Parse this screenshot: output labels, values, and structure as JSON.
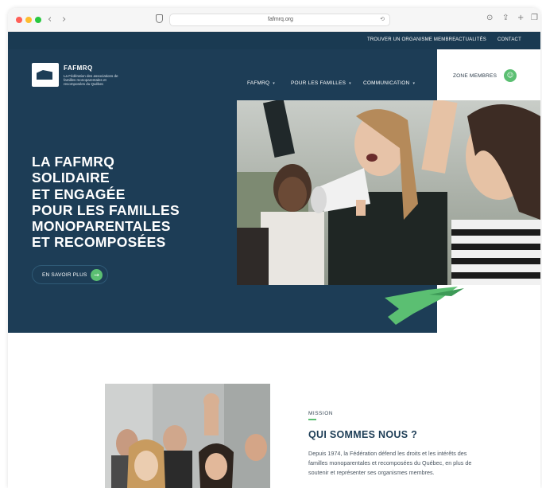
{
  "browser": {
    "url": "fafmrq.org",
    "colors": {
      "close": "#ff5f57",
      "minimize": "#febc2e",
      "maximize": "#28c840"
    }
  },
  "topbar": {
    "links": [
      "TROUVER UN ORGANISME MEMBRE",
      "ACTUALITÉS",
      "CONTACT"
    ]
  },
  "header": {
    "brand": "FAFMRQ",
    "brand_subtitle": "La Fédération des associations de familles monoparentales et recomposées du Québec",
    "nav": [
      "FAFMRQ",
      "POUR LES FAMILLES",
      "COMMUNICATION"
    ],
    "zone_label": "ZONE MEMBRES"
  },
  "hero": {
    "headline_lines": [
      "LA FAFMRQ",
      "SOLIDAIRE",
      "ET ENGAGÉE",
      "POUR LES FAMILLES",
      "MONOPARENTALES",
      "ET RECOMPOSÉES"
    ],
    "cta_label": "EN SAVOIR PLUS"
  },
  "mission": {
    "eyebrow": "MISSION",
    "title": "QUI SOMMES NOUS ?",
    "body": "Depuis 1974, la Fédération défend les droits et les intérêts des familles monoparentales et recomposées du Québec, en plus de soutenir et représenter ses organismes membres."
  },
  "theme": {
    "navy": "#1d3d56",
    "navy_dark": "#1a3a52",
    "accent_green": "#5bbf72"
  },
  "icons": {
    "back": "chevron-left-icon",
    "forward": "chevron-right-icon",
    "privacy": "shield-icon",
    "translate": "translate-icon",
    "reload": "reload-icon",
    "download": "download-icon",
    "share": "share-icon",
    "new_tab": "plus-icon",
    "tabs": "tabs-icon",
    "zone": "user-icon",
    "cta": "arrow-right-icon"
  }
}
